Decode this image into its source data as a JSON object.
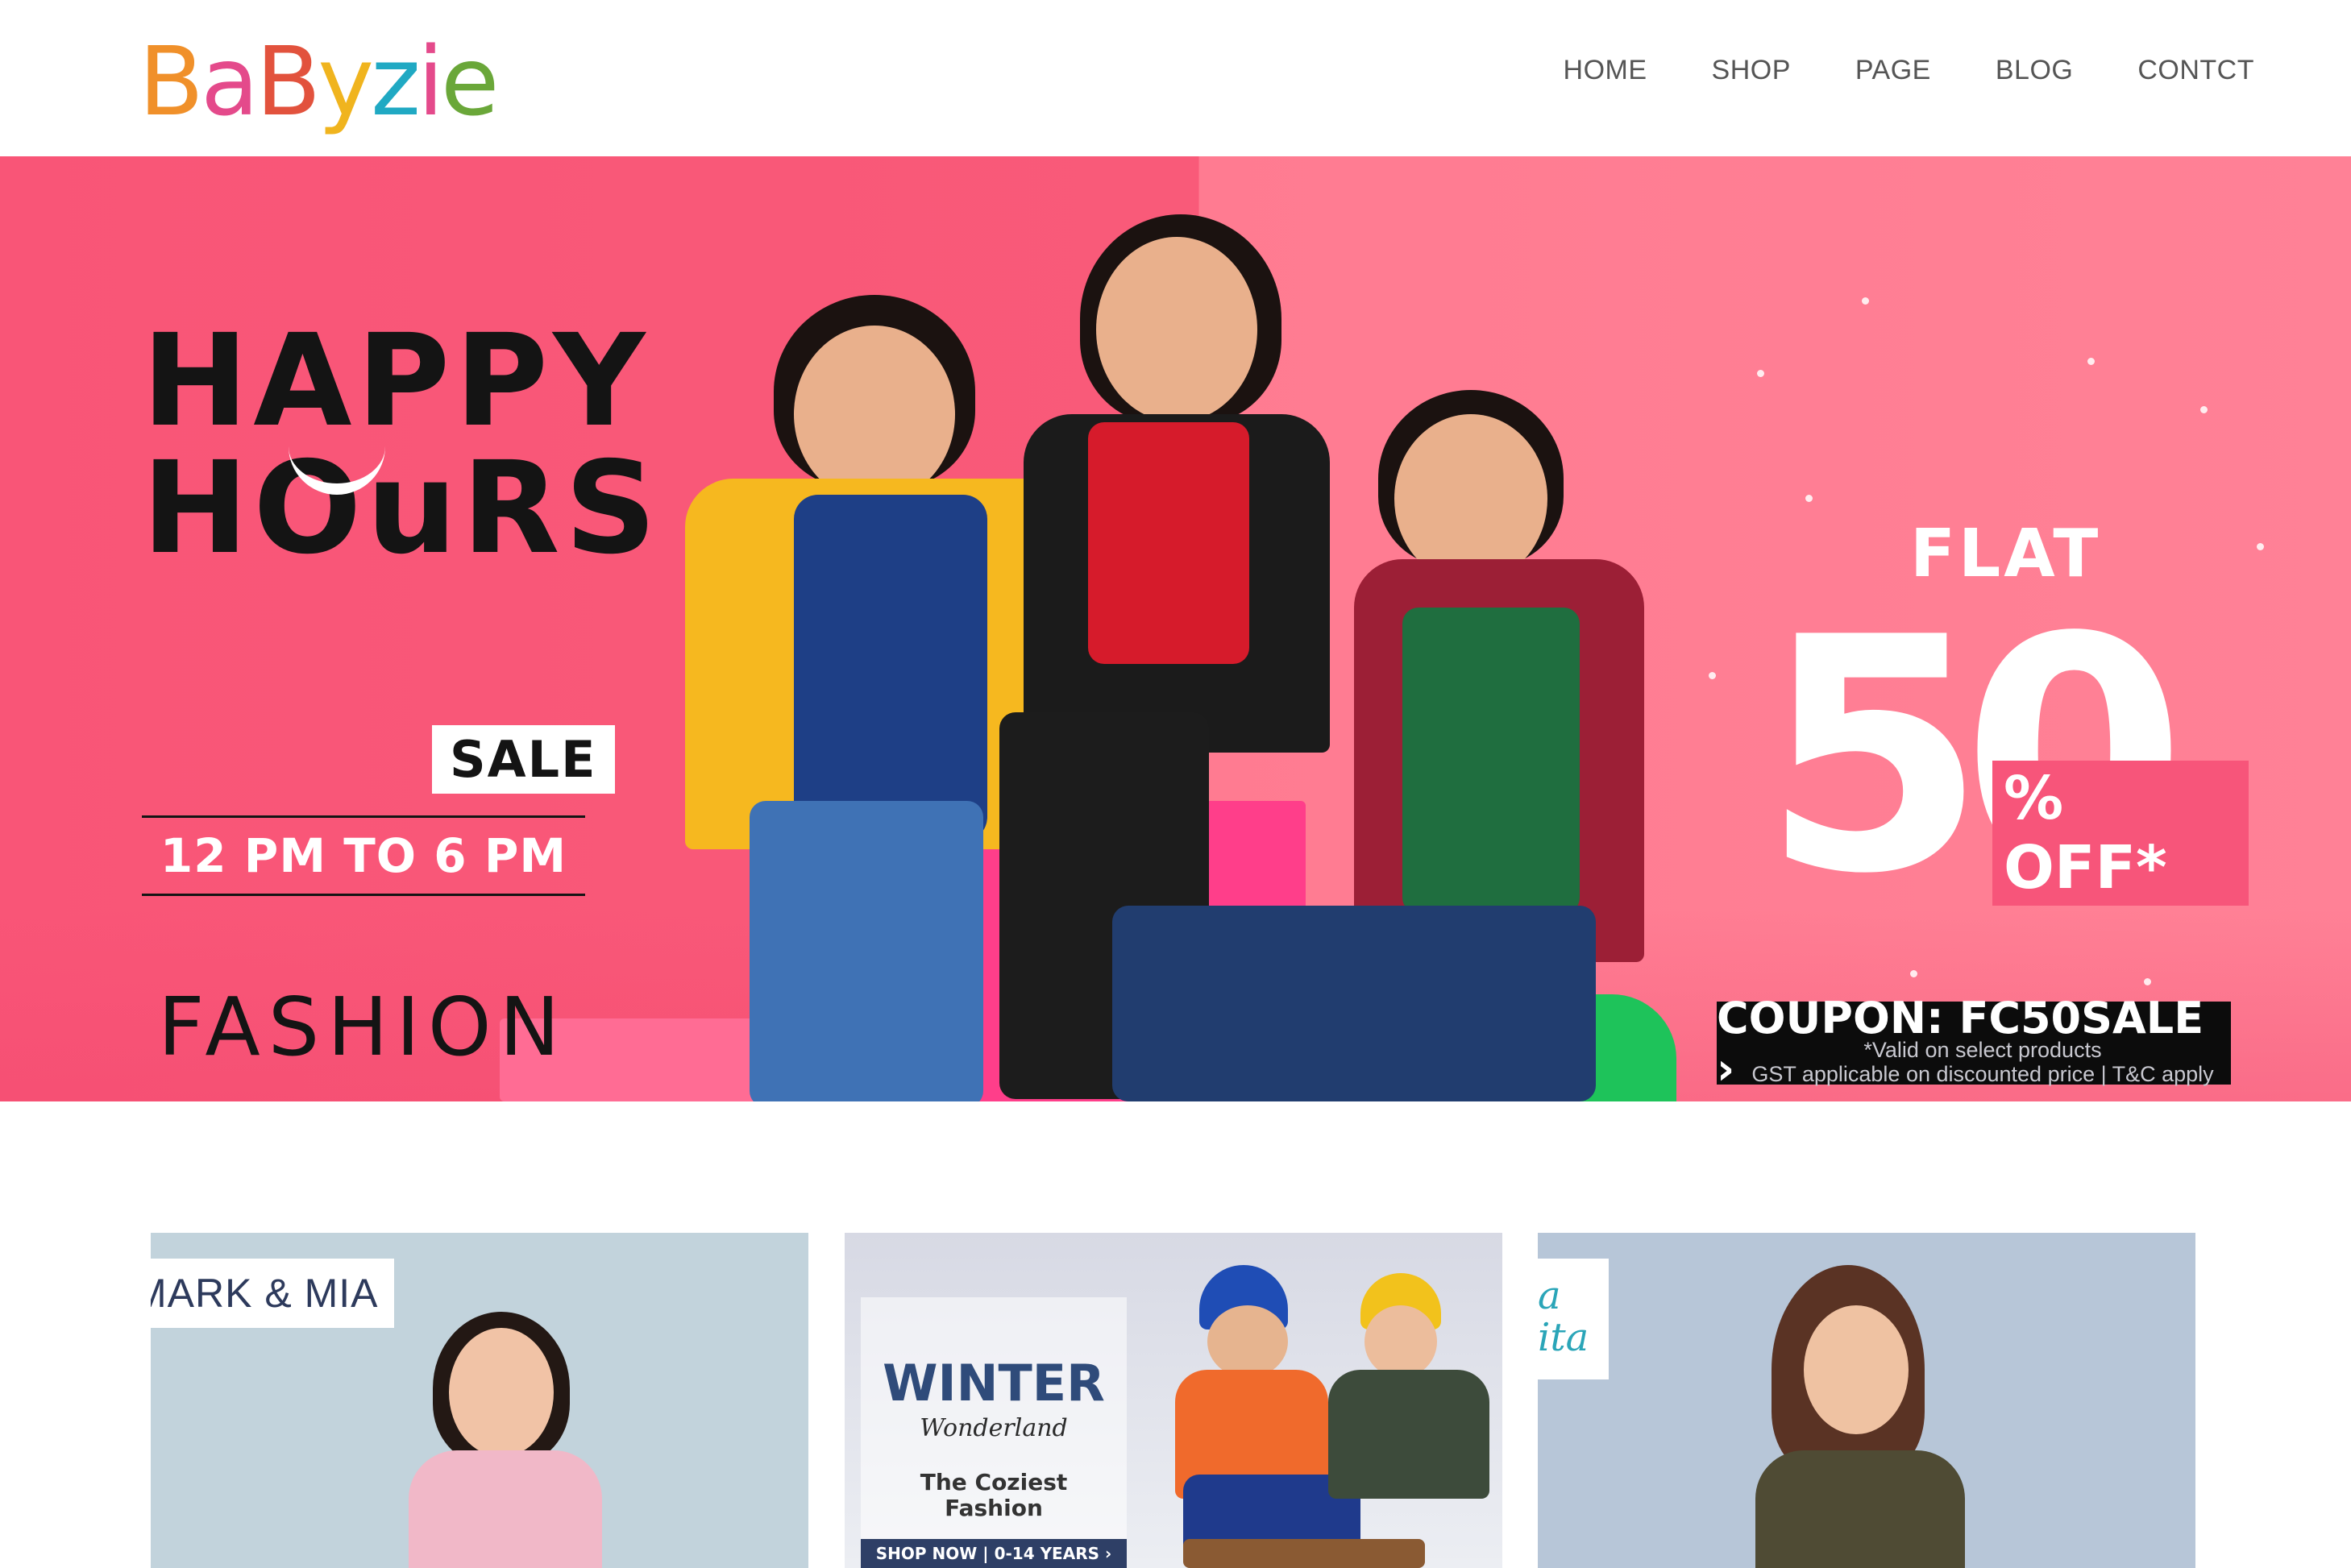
{
  "brand": {
    "logo_letters": [
      "B",
      "a",
      "B",
      "y",
      "z",
      "i",
      "e"
    ],
    "logo_colors": [
      "#f0902a",
      "#e44a8b",
      "#e2523d",
      "#f0b41e",
      "#20a9c3",
      "#e44a8b",
      "#6aa739"
    ]
  },
  "nav": {
    "items": [
      "HOME",
      "SHOP",
      "PAGE",
      "BLOG",
      "CONTCT"
    ]
  },
  "hero": {
    "headline_line1": "HAPPY",
    "headline_line2": "HOuRS",
    "sale_label": "SALE",
    "time_range": "12 PM TO 6 PM",
    "category": "FASHION",
    "flat_label": "FLAT",
    "discount_number": "50",
    "discount_suffix": "% OFF*",
    "coupon_label": "COUPON: FC50SALE ›",
    "fineprint_line1": "*Valid on select products",
    "fineprint_line2": "GST applicable on discounted price | T&C apply",
    "colors": {
      "left_bg": "#f95577",
      "right_bg": "#ff7e94"
    }
  },
  "cards": {
    "card1": {
      "brand_tag": "MARK & MIA"
    },
    "card2": {
      "title": "WINTER",
      "subtitle": "Wonderland",
      "tagline_line1": "The Coziest",
      "tagline_line2": "Fashion",
      "cta": "SHOP NOW | 0-14 YEARS ›"
    },
    "card3": {
      "brand_tag_line1": "a",
      "brand_tag_line2": "ita"
    }
  }
}
